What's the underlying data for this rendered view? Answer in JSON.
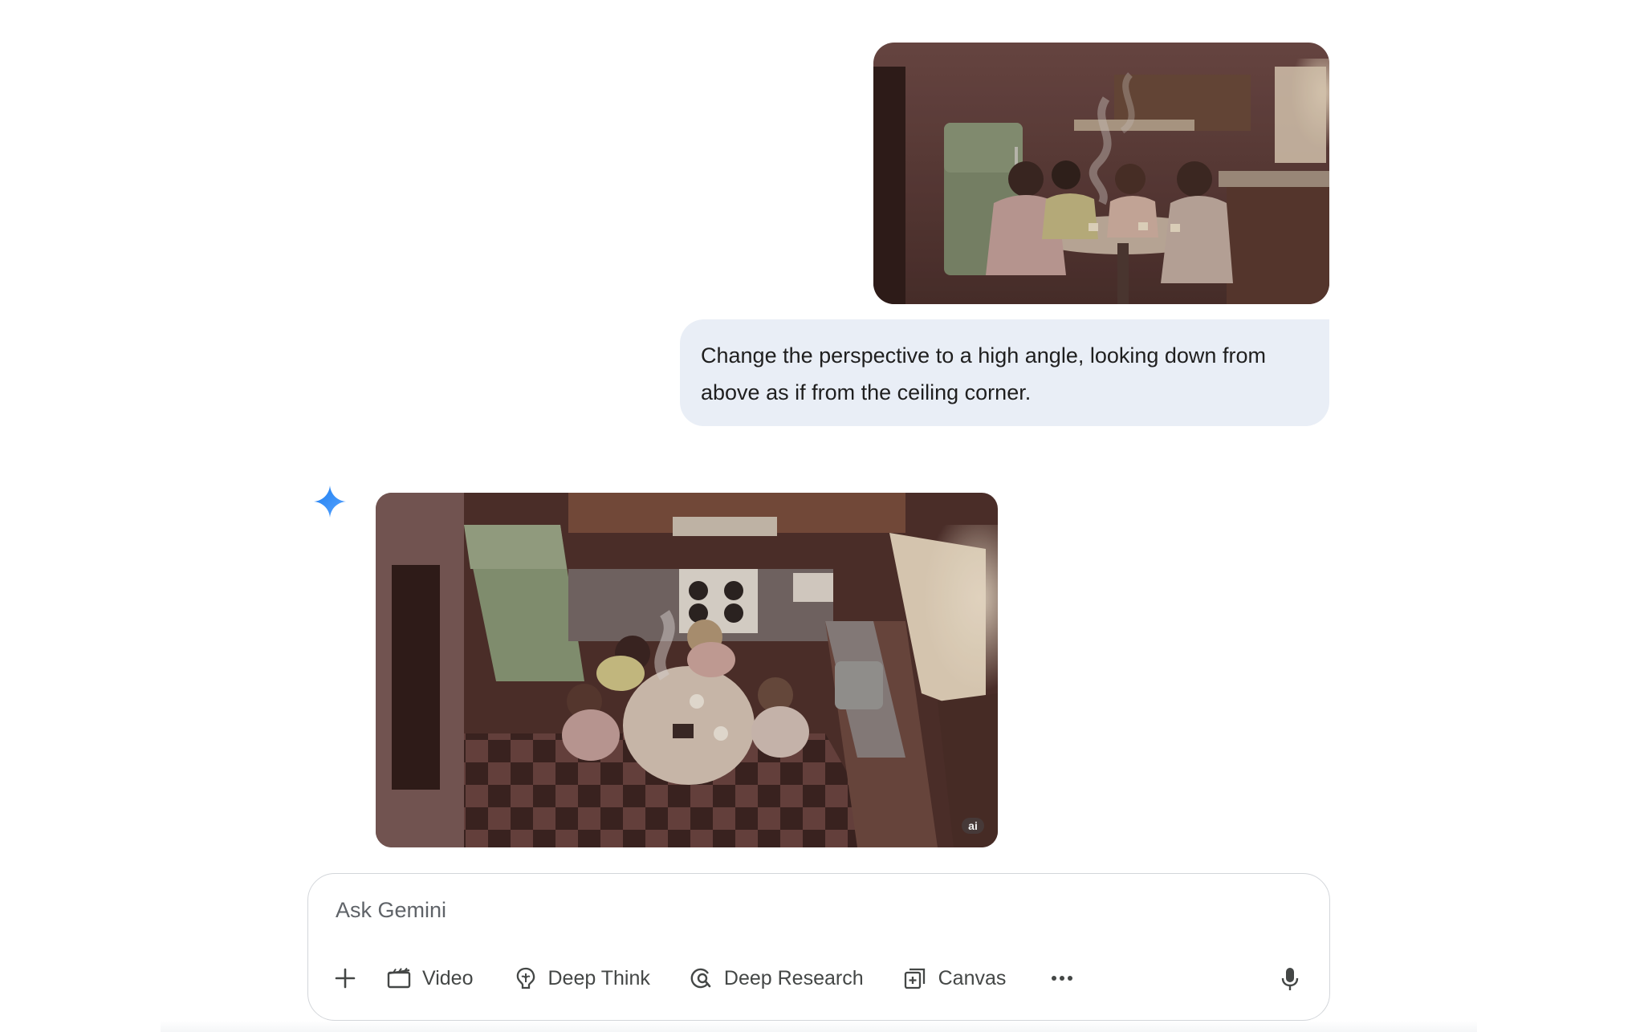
{
  "conversation": {
    "user_turn": {
      "image_alt": "Kitchen scene with four people around a table, eye-level view",
      "prompt_line1": "Change the perspective to a high angle, looking down from",
      "prompt_line2": "above as if from the ceiling corner."
    },
    "model_turn": {
      "avatar_icon": "gemini-spark-icon",
      "image_alt": "Kitchen scene from a high angle, looking down from the ceiling corner",
      "ai_badge": "ai"
    }
  },
  "composer": {
    "placeholder": "Ask Gemini",
    "tools": {
      "add_icon": "plus-icon",
      "video": "Video",
      "deep_think": "Deep Think",
      "deep_research": "Deep Research",
      "canvas": "Canvas",
      "more_icon": "more-horizontal-icon",
      "mic_icon": "microphone-icon"
    }
  },
  "colors": {
    "prompt_bubble": "#e9eef6",
    "spark_accent": "#4285f4",
    "input_border": "#d3d6da",
    "toolbar_text": "#444746"
  }
}
